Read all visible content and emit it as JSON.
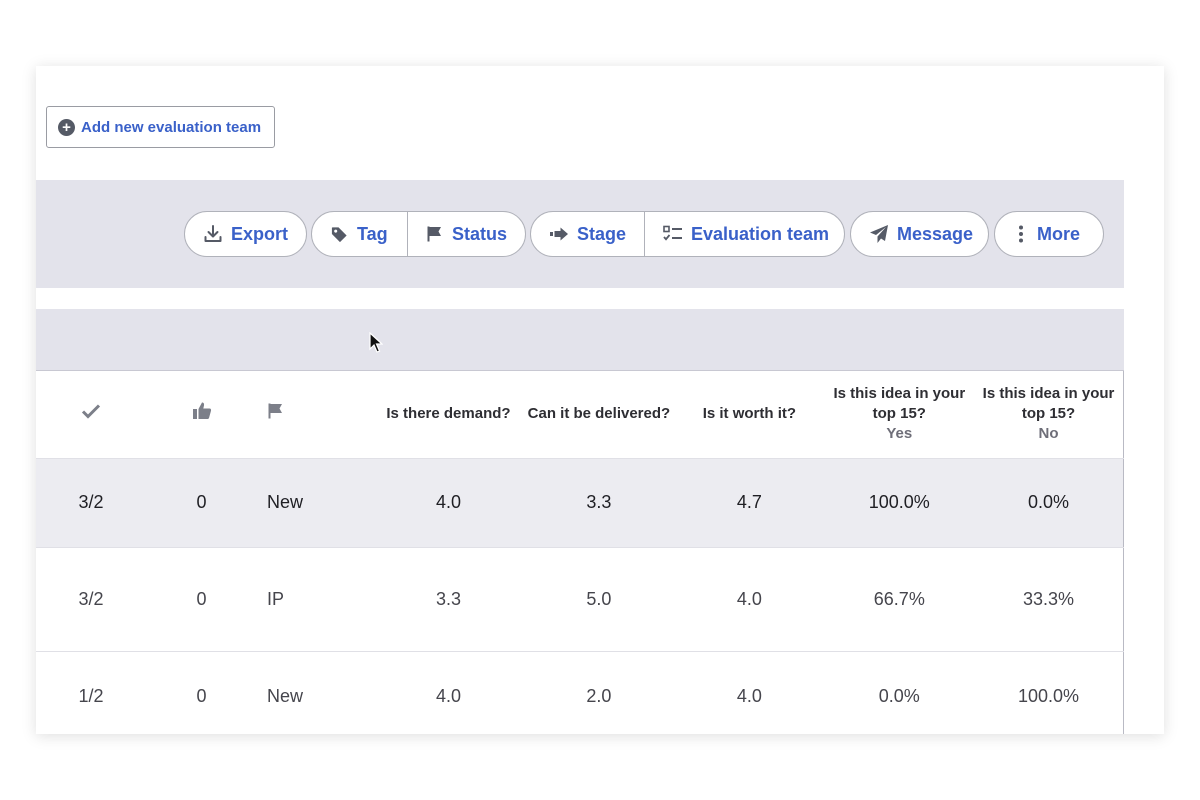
{
  "add_team_button": {
    "label": "Add new evaluation team",
    "icon": "plus-circle-icon"
  },
  "toolbar": {
    "export_label": "Export",
    "tag_label": "Tag",
    "status_label": "Status",
    "stage_label": "Stage",
    "evaluation_team_label": "Evaluation team",
    "message_label": "Message",
    "more_label": "More"
  },
  "table": {
    "header_icons": [
      "checkmark-icon",
      "thumbs-up-icon",
      "flag-icon"
    ],
    "columns": [
      {
        "label": "Is there demand?",
        "sub": ""
      },
      {
        "label": "Can it be delivered?",
        "sub": ""
      },
      {
        "label": "Is it worth it?",
        "sub": ""
      },
      {
        "label": "Is this idea in your top 15?",
        "sub": "Yes"
      },
      {
        "label": "Is this idea in your top 15?",
        "sub": "No"
      }
    ],
    "rows": [
      {
        "check": "3/2",
        "likes": "0",
        "status": "New",
        "demand": "4.0",
        "delivered": "3.3",
        "worth": "4.7",
        "top15_yes": "100.0%",
        "top15_no": "0.0%"
      },
      {
        "check": "3/2",
        "likes": "0",
        "status": "IP",
        "demand": "3.3",
        "delivered": "5.0",
        "worth": "4.0",
        "top15_yes": "66.7%",
        "top15_no": "33.3%"
      },
      {
        "check": "1/2",
        "likes": "0",
        "status": "New",
        "demand": "4.0",
        "delivered": "2.0",
        "worth": "4.0",
        "top15_yes": "0.0%",
        "top15_no": "100.0%"
      }
    ]
  },
  "colors": {
    "accent": "#3a61c9",
    "toolbar_bg": "#e3e3eb",
    "highlight_row": "#ececf1"
  }
}
